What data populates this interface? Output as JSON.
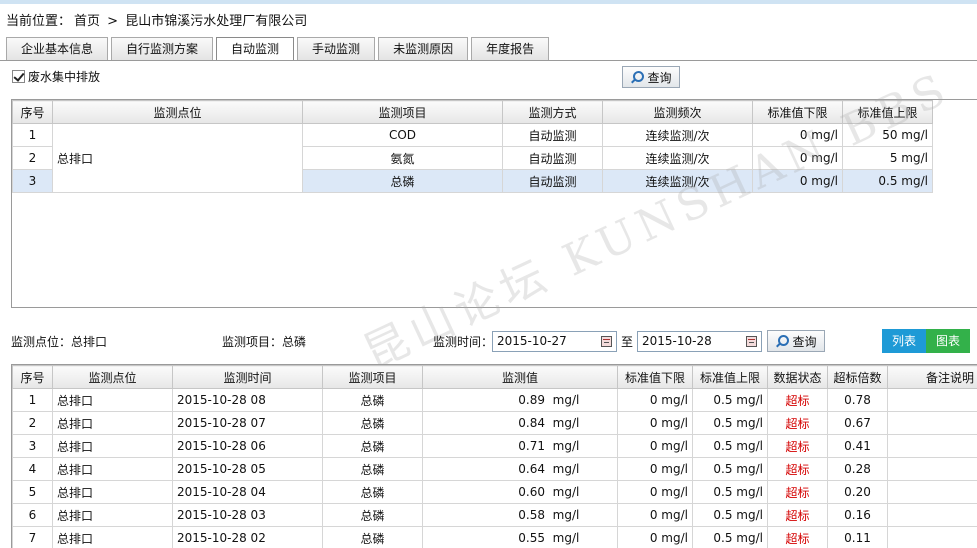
{
  "breadcrumb": {
    "prefix": "当前位置：",
    "home": "首页",
    "sep": ">",
    "company": "昆山市锦溪污水处理厂有限公司"
  },
  "tabs": [
    {
      "label": "企业基本信息"
    },
    {
      "label": "自行监测方案"
    },
    {
      "label": "自动监测",
      "active": true
    },
    {
      "label": "手动监测"
    },
    {
      "label": "未监测原因"
    },
    {
      "label": "年度报告"
    }
  ],
  "top": {
    "checkbox_label": "废水集中排放",
    "checkbox_checked": true,
    "query_label": "查询"
  },
  "table1": {
    "headers": [
      "序号",
      "监测点位",
      "监测项目",
      "监测方式",
      "监测频次",
      "标准值下限",
      "标准值上限"
    ],
    "point": "总排口",
    "rows": [
      {
        "no": "1",
        "item": "COD",
        "method": "自动监测",
        "freq": "连续监测/次",
        "low": "0 mg/l",
        "high": "50 mg/l"
      },
      {
        "no": "2",
        "item": "氨氮",
        "method": "自动监测",
        "freq": "连续监测/次",
        "low": "0 mg/l",
        "high": "5 mg/l"
      },
      {
        "no": "3",
        "item": "总磷",
        "method": "自动监测",
        "freq": "连续监测/次",
        "low": "0 mg/l",
        "high": "0.5 mg/l"
      }
    ]
  },
  "watermark": "昆山论坛 KUNSHAN BBS",
  "filter": {
    "point_label": "监测点位：总排口",
    "item_label": "监测项目：总磷",
    "time_label": "监测时间：",
    "start": "2015-10-27",
    "to": "至",
    "end": "2015-10-28",
    "query_label": "查询",
    "list_label": "列表",
    "chart_label": "图表",
    "list_color": "#1e9ad6",
    "chart_color": "#33b14a"
  },
  "table2": {
    "headers": [
      "序号",
      "监测点位",
      "监测时间",
      "监测项目",
      "监测值",
      "标准值下限",
      "标准值上限",
      "数据状态",
      "超标倍数",
      "备注说明"
    ],
    "rows": [
      {
        "no": "1",
        "point": "总排口",
        "time": "2015-10-28 08",
        "item": "总磷",
        "value": "0.89",
        "unit": "mg/l",
        "low": "0 mg/l",
        "high": "0.5 mg/l",
        "status": "超标",
        "ratio": "0.78",
        "note": ""
      },
      {
        "no": "2",
        "point": "总排口",
        "time": "2015-10-28 07",
        "item": "总磷",
        "value": "0.84",
        "unit": "mg/l",
        "low": "0 mg/l",
        "high": "0.5 mg/l",
        "status": "超标",
        "ratio": "0.67",
        "note": ""
      },
      {
        "no": "3",
        "point": "总排口",
        "time": "2015-10-28 06",
        "item": "总磷",
        "value": "0.71",
        "unit": "mg/l",
        "low": "0 mg/l",
        "high": "0.5 mg/l",
        "status": "超标",
        "ratio": "0.41",
        "note": ""
      },
      {
        "no": "4",
        "point": "总排口",
        "time": "2015-10-28 05",
        "item": "总磷",
        "value": "0.64",
        "unit": "mg/l",
        "low": "0 mg/l",
        "high": "0.5 mg/l",
        "status": "超标",
        "ratio": "0.28",
        "note": ""
      },
      {
        "no": "5",
        "point": "总排口",
        "time": "2015-10-28 04",
        "item": "总磷",
        "value": "0.60",
        "unit": "mg/l",
        "low": "0 mg/l",
        "high": "0.5 mg/l",
        "status": "超标",
        "ratio": "0.20",
        "note": ""
      },
      {
        "no": "6",
        "point": "总排口",
        "time": "2015-10-28 03",
        "item": "总磷",
        "value": "0.58",
        "unit": "mg/l",
        "low": "0 mg/l",
        "high": "0.5 mg/l",
        "status": "超标",
        "ratio": "0.16",
        "note": ""
      },
      {
        "no": "7",
        "point": "总排口",
        "time": "2015-10-28 02",
        "item": "总磷",
        "value": "0.55",
        "unit": "mg/l",
        "low": "0 mg/l",
        "high": "0.5 mg/l",
        "status": "超标",
        "ratio": "0.11",
        "note": ""
      }
    ]
  }
}
